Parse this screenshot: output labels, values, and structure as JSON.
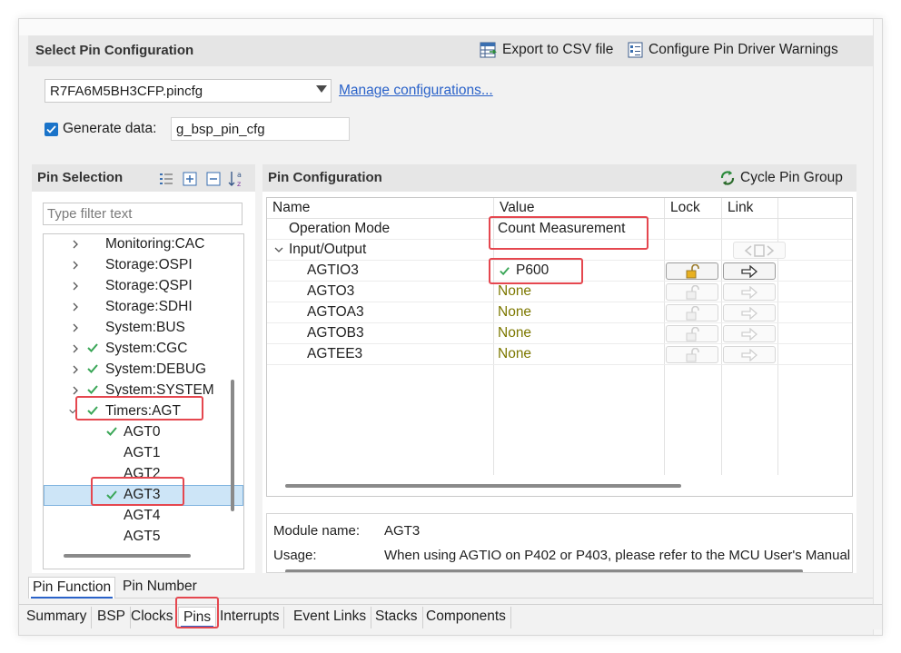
{
  "section_title": "Select Pin Configuration",
  "export_label": "Export to CSV file",
  "warnings_label": "Configure Pin Driver Warnings",
  "config_file": "R7FA6M5BH3CFP.pincfg",
  "manage_link": "Manage configurations...",
  "generate_label": "Generate data:",
  "generate_value": "g_bsp_pin_cfg",
  "pin_selection": {
    "title": "Pin Selection",
    "filter_placeholder": "Type filter text",
    "items": [
      {
        "label": "Monitoring:CAC"
      },
      {
        "label": "Storage:OSPI"
      },
      {
        "label": "Storage:QSPI"
      },
      {
        "label": "Storage:SDHI"
      },
      {
        "label": "System:BUS"
      },
      {
        "label": "System:CGC"
      },
      {
        "label": "System:DEBUG"
      },
      {
        "label": "System:SYSTEM"
      },
      {
        "label": "Timers:AGT"
      },
      {
        "label": "AGT0"
      },
      {
        "label": "AGT1"
      },
      {
        "label": "AGT2"
      },
      {
        "label": "AGT3"
      },
      {
        "label": "AGT4"
      },
      {
        "label": "AGT5"
      }
    ]
  },
  "pin_config": {
    "title": "Pin Configuration",
    "cycle_label": "Cycle Pin Group",
    "columns": [
      "Name",
      "Value",
      "Lock",
      "Link"
    ],
    "rows": [
      {
        "name": "Operation Mode",
        "value": "Count Measurement"
      },
      {
        "name": "Input/Output",
        "value": ""
      },
      {
        "name": "AGTIO3",
        "value": "P600"
      },
      {
        "name": "AGTO3",
        "value": "None"
      },
      {
        "name": "AGTOA3",
        "value": "None"
      },
      {
        "name": "AGTOB3",
        "value": "None"
      },
      {
        "name": "AGTEE3",
        "value": "None"
      }
    ]
  },
  "details": {
    "module_label": "Module name:",
    "module_value": "AGT3",
    "usage_label": "Usage:",
    "usage_value": "When using AGTIO on P402 or P403, please refer to the MCU User's Manual"
  },
  "sub_tabs": [
    "Pin Function",
    "Pin Number"
  ],
  "bottom_tabs": [
    "Summary",
    "BSP",
    "Clocks",
    "Pins",
    "Interrupts",
    "Event Links",
    "Stacks",
    "Components"
  ],
  "colors": {
    "check_green": "#3aa657",
    "highlight_red": "#e5474f",
    "link_blue": "#2a62c9",
    "none_olive": "#7d7800"
  }
}
